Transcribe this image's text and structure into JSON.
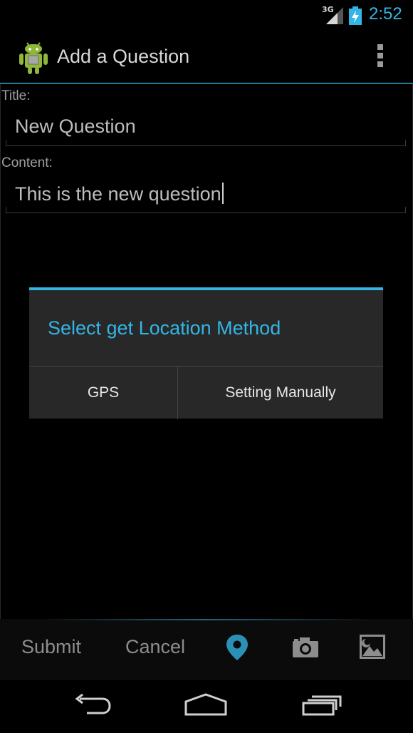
{
  "status_bar": {
    "network_label": "3G",
    "time": "2:52",
    "accent_color": "#33b5e5"
  },
  "action_bar": {
    "title": "Add a Question",
    "app_icon": "android-robot-icon",
    "overflow_icon": "overflow-menu-icon"
  },
  "form": {
    "title_label": "Title:",
    "title_value": "New Question",
    "content_label": "Content:",
    "content_value": "This is the new question"
  },
  "dialog": {
    "title": "Select get Location Method",
    "buttons": [
      "GPS",
      "Setting Manually"
    ]
  },
  "bottom_bar": {
    "submit_label": "Submit",
    "cancel_label": "Cancel",
    "icons": [
      "location-pin-icon",
      "camera-icon",
      "picture-icon"
    ]
  },
  "nav_bar": {
    "icons": [
      "back-icon",
      "home-icon",
      "recent-apps-icon"
    ]
  }
}
